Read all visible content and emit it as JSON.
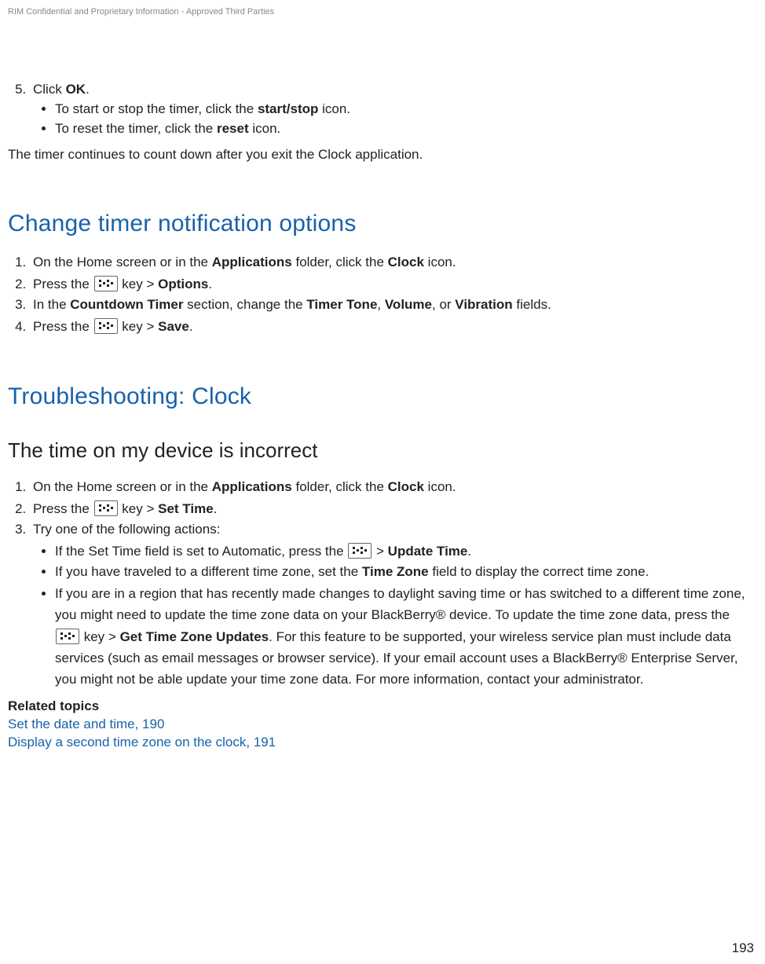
{
  "header": {
    "confidential": "RIM Confidential and Proprietary Information - Approved Third Parties"
  },
  "intro": {
    "step5_num": "5.",
    "step5_pre": "Click ",
    "step5_bold": "OK",
    "step5_post": ".",
    "bullet1_pre": "To start or stop the timer, click the ",
    "bullet1_bold": "start/stop",
    "bullet1_post": " icon.",
    "bullet2_pre": "To reset the timer, click the ",
    "bullet2_bold": "reset",
    "bullet2_post": " icon.",
    "para": "The timer continues to count down after you exit the Clock application."
  },
  "section_change": {
    "title": "Change timer notification options",
    "step1_pre": "On the Home screen or in the ",
    "step1_b1": "Applications",
    "step1_mid": " folder, click the ",
    "step1_b2": "Clock",
    "step1_post": " icon.",
    "step2_pre": "Press the ",
    "step2_mid": " key > ",
    "step2_b": "Options",
    "step2_post": ".",
    "step3_pre": "In the ",
    "step3_b1": "Countdown Timer",
    "step3_mid1": " section, change the ",
    "step3_b2": "Timer Tone",
    "step3_mid2": ", ",
    "step3_b3": "Volume",
    "step3_mid3": ", or ",
    "step3_b4": "Vibration",
    "step3_post": " fields.",
    "step4_pre": "Press the ",
    "step4_mid": " key > ",
    "step4_b": "Save",
    "step4_post": "."
  },
  "section_trouble": {
    "title": "Troubleshooting: Clock",
    "subtitle": "The time on my device is incorrect",
    "step1_pre": "On the Home screen or in the ",
    "step1_b1": "Applications",
    "step1_mid": " folder, click the ",
    "step1_b2": "Clock",
    "step1_post": " icon.",
    "step2_pre": "Press the ",
    "step2_mid": " key > ",
    "step2_b": "Set Time",
    "step2_post": ".",
    "step3": "Try one of the following actions:",
    "b1_pre": "If the Set Time field is set to Automatic, press the ",
    "b1_mid": " > ",
    "b1_b": "Update Time",
    "b1_post": ".",
    "b2_pre": "If you have traveled to a different time zone, set the ",
    "b2_b": "Time Zone",
    "b2_post": " field to display the correct time zone.",
    "b3_pre": "If you are in a region that has recently made changes to daylight saving time or has switched to a different time zone, you might need to update the time zone data on your BlackBerry® device. To update the time zone data, press the ",
    "b3_mid": " key > ",
    "b3_b": "Get Time Zone Updates",
    "b3_post": ". For this feature to be supported, your wireless service plan must include data services (such as email messages or browser service). If your email account uses a BlackBerry® Enterprise Server, you might not be able update your time zone data. For more information, contact your administrator."
  },
  "related": {
    "heading": "Related topics",
    "link1": "Set the date and time, 190",
    "link2": "Display a second time zone on the clock, 191"
  },
  "footer": {
    "page_number": "193"
  }
}
